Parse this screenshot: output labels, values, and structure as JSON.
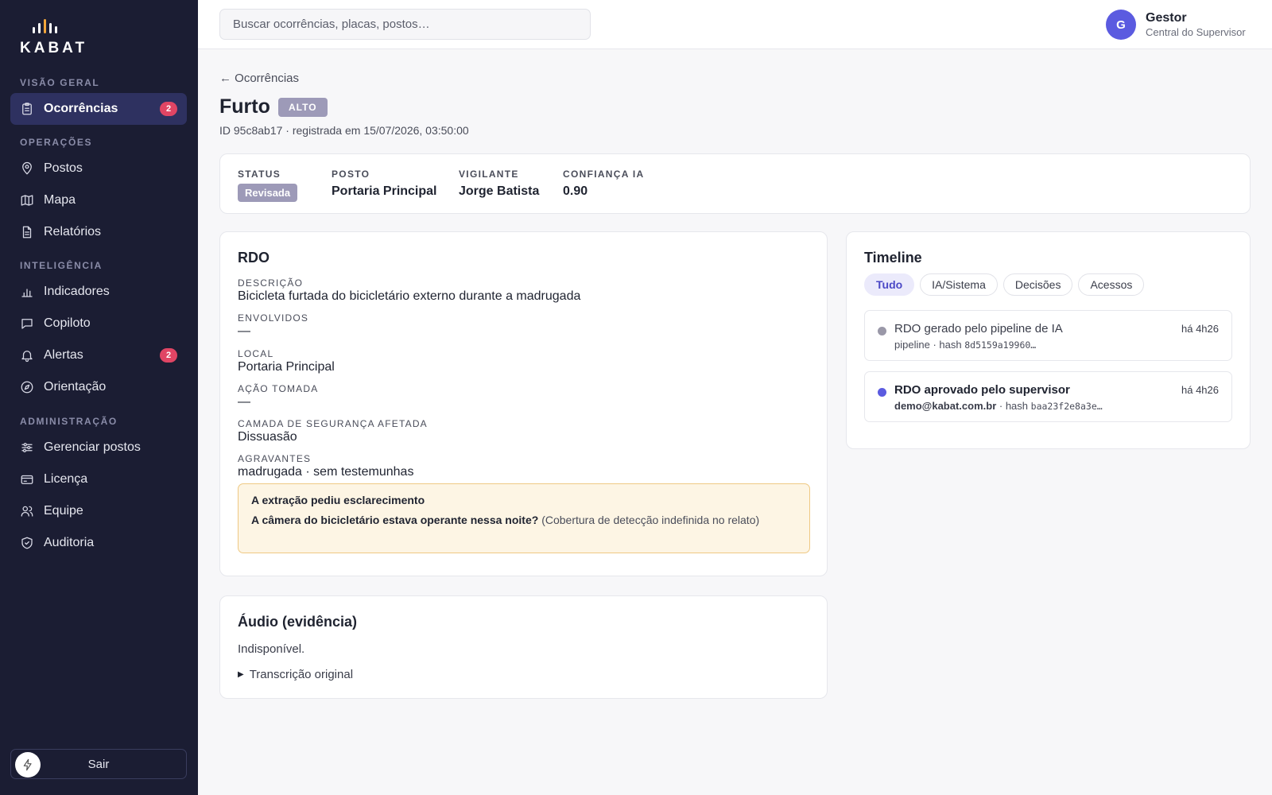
{
  "brand": {
    "name": "KABAT"
  },
  "sidebar": {
    "sections": [
      {
        "title": "VISÃO GERAL"
      },
      {
        "title": "OPERAÇÕES"
      },
      {
        "title": "INTELIGÊNCIA"
      },
      {
        "title": "ADMINISTRAÇÃO"
      }
    ],
    "items": [
      {
        "label": "Ocorrências",
        "icon": "clipboard-icon",
        "badge": "2",
        "active": true
      },
      {
        "label": "Postos",
        "icon": "map-pin-icon"
      },
      {
        "label": "Mapa",
        "icon": "map-icon"
      },
      {
        "label": "Relatórios",
        "icon": "file-text-icon"
      },
      {
        "label": "Indicadores",
        "icon": "bar-chart-icon"
      },
      {
        "label": "Copiloto",
        "icon": "chat-icon"
      },
      {
        "label": "Alertas",
        "icon": "bell-icon",
        "badge": "2"
      },
      {
        "label": "Orientação",
        "icon": "compass-icon"
      },
      {
        "label": "Gerenciar postos",
        "icon": "sliders-icon"
      },
      {
        "label": "Licença",
        "icon": "credit-card-icon"
      },
      {
        "label": "Equipe",
        "icon": "users-icon"
      },
      {
        "label": "Auditoria",
        "icon": "shield-check-icon"
      }
    ],
    "logout_label": "Sair"
  },
  "topbar": {
    "search_placeholder": "Buscar ocorrências, placas, postos…",
    "user": {
      "initial": "G",
      "name": "Gestor",
      "role": "Central do Supervisor"
    }
  },
  "header": {
    "back_label": "← Ocorrências",
    "title": "Furto",
    "severity": "ALTO",
    "meta": "ID 95c8ab17 · registrada em 15/07/2026, 03:50:00"
  },
  "summary": {
    "status_label": "STATUS",
    "status_value": "Revisada",
    "post_label": "POSTO",
    "post_value": "Portaria Principal",
    "guard_label": "VIGILANTE",
    "guard_value": "Jorge Batista",
    "confidence_label": "CONFIANÇA IA",
    "confidence_value": "0.90"
  },
  "rdo": {
    "title": "RDO",
    "fields": [
      {
        "label": "DESCRIÇÃO",
        "value": "Bicicleta furtada do bicicletário externo durante a madrugada"
      },
      {
        "label": "ENVOLVIDOS",
        "value": "—"
      },
      {
        "label": "LOCAL",
        "value": "Portaria Principal"
      },
      {
        "label": "AÇÃO TOMADA",
        "value": "—"
      },
      {
        "label": "CAMADA DE SEGURANÇA AFETADA",
        "value": "Dissuasão"
      },
      {
        "label": "AGRAVANTES",
        "value": "madrugada · sem testemunhas"
      }
    ],
    "clarification": {
      "title": "A extração pediu esclarecimento",
      "question": "A câmera do bicicletário estava operante nessa noite?",
      "note": "(Cobertura de detecção indefinida no relato)"
    }
  },
  "audio": {
    "title": "Áudio (evidência)",
    "status": "Indisponível.",
    "transcript_label": "Transcrição original"
  },
  "timeline": {
    "title": "Timeline",
    "filters": [
      "Tudo",
      "IA/Sistema",
      "Decisões",
      "Acessos"
    ],
    "active_filter": "Tudo",
    "events": [
      {
        "title": "RDO gerado pelo pipeline de IA",
        "actor": "pipeline",
        "hash_label": "· hash",
        "hash": "8d5159a19960…",
        "time": "há 4h26",
        "dot_color": "#9a98a8"
      },
      {
        "title": "RDO aprovado pelo supervisor",
        "actor": "demo@kabat.com.br",
        "hash_label": "· hash",
        "hash": "baa23f2e8a3e…",
        "time": "há 4h26",
        "dot_color": "#5b5be0"
      }
    ]
  },
  "colors": {
    "sidebar_bg": "#1b1d33",
    "accent": "#5b5be0",
    "badge": "#e04564",
    "severity": "#9d9ab8"
  }
}
